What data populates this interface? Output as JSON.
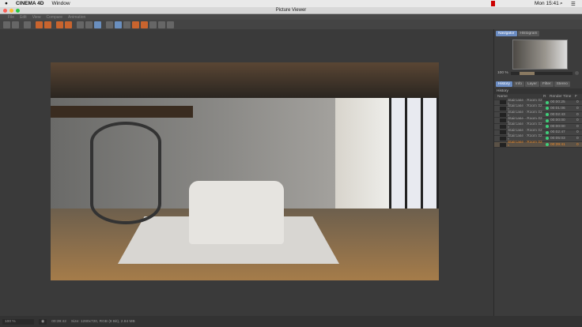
{
  "menubar": {
    "app": "CINEMA 4D",
    "window": "Window",
    "clock": "Mon 15:41"
  },
  "window_title": "Picture Viewer",
  "menu": [
    "File",
    "Edit",
    "View",
    "Compare",
    "Animation"
  ],
  "navigator": {
    "tabs": [
      "Navigator",
      "Histogram"
    ],
    "zoom": "100 %"
  },
  "history": {
    "tabs": [
      "History",
      "Info",
      "Layer",
      "Filter",
      "Stereo"
    ],
    "title": "History",
    "columns": [
      "Name",
      "R",
      "Render Time",
      "F"
    ],
    "rows": [
      {
        "name": "Staircase - Room 02 *",
        "time": "00:00:25",
        "f": "0"
      },
      {
        "name": "Staircase - Room 02 *",
        "time": "00:01:06",
        "f": "0"
      },
      {
        "name": "Staircase - Room 02 *",
        "time": "00:02:43",
        "f": "0"
      },
      {
        "name": "Staircase - Room 02 *",
        "time": "00:00:00",
        "f": "0"
      },
      {
        "name": "Staircase - Room 02 *",
        "time": "00:00:00",
        "f": "0"
      },
      {
        "name": "Staircase - Room 02 *",
        "time": "00:02:47",
        "f": "0"
      },
      {
        "name": "Staircase - Room 02 *",
        "time": "00:05:03",
        "f": "0"
      },
      {
        "name": "Staircase - Room 02 *",
        "time": "00:39:41",
        "f": "0"
      }
    ],
    "selected_index": 7
  },
  "status": {
    "zoom": "100 %",
    "time": "00:39:42",
    "info": "Size: 1280x720, RGB (8 Bit), 2.84 MB"
  }
}
